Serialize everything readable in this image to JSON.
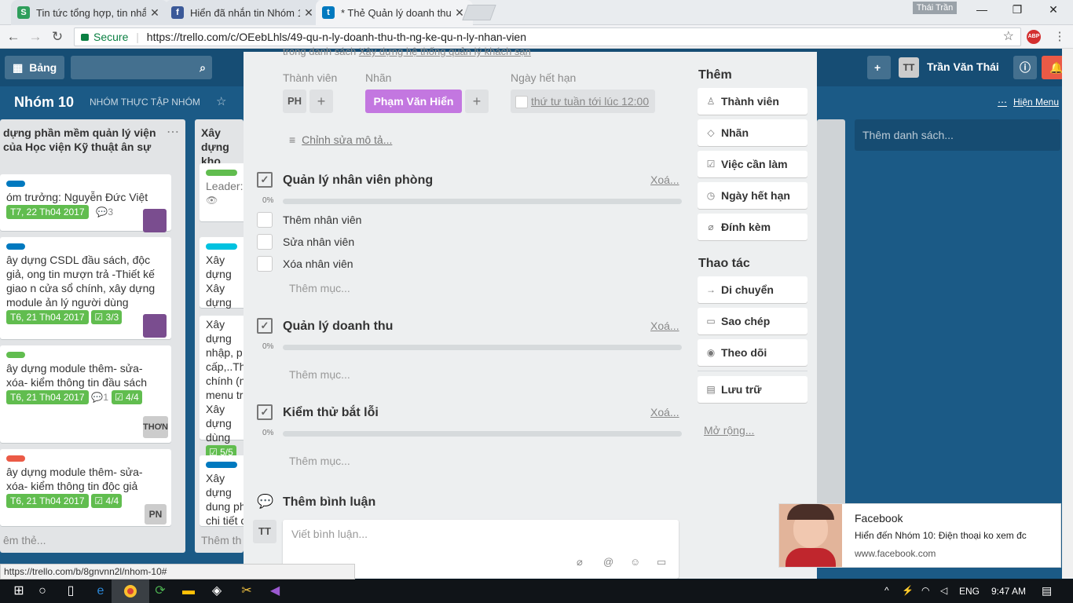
{
  "browser": {
    "tabs": [
      {
        "label": "Tin tức tổng hợp, tin nhắ",
        "icon": "S"
      },
      {
        "label": "Hiển đã nhắn tin Nhóm 1",
        "icon": "f"
      },
      {
        "label": "* Thẻ Quản lý doanh thu",
        "icon": "t"
      }
    ],
    "user": "Thái Trần",
    "secure_label": "Secure",
    "url": "https://trello.com/c/OEebLhls/49-qu-n-ly-doanh-thu-th-ng-ke-qu-n-ly-nhan-vien",
    "status_url": "https://trello.com/b/8gnvnn2l/nhom-10#"
  },
  "board": {
    "boards_label": "Bảng",
    "name": "Nhóm 10",
    "team": "NHÓM THỰC TẬP NHÓM",
    "user_name": "Trần Văn Thái",
    "user_initials": "TT",
    "show_menu": "Hiện Menu",
    "add_list": "Thêm danh sách...",
    "list1": {
      "title": "dựng phần mềm quản lý viện của Học viện Kỹ thuật ân sự",
      "cards": [
        {
          "text": "óm trưởng: Nguyễn Đức Việt",
          "due": "T7, 22 Th04 2017",
          "comments": "3"
        },
        {
          "text": "ây dựng CSDL đầu sách, độc giả, ong tin mượn trả -Thiết kế giao n cửa sổ chính, xây dựng module ản lý người dùng",
          "due": "T6, 21 Th04 2017",
          "check": "3/3"
        },
        {
          "text": "ây dựng module thêm- sửa- xóa- kiểm thông tin đầu sách",
          "due": "T6, 21 Th04 2017",
          "comments": "1",
          "check": "4/4",
          "member": "THƠN"
        },
        {
          "text": "ây dựng module thêm- sửa- xóa- kiểm thông tin độc giả",
          "due": "T6, 21 Th04 2017",
          "check": "4/4",
          "member": "PN"
        }
      ],
      "add": "êm thẻ..."
    },
    "list2": {
      "title": "Xây dựng kho",
      "cards": [
        {
          "text": "Leader:"
        },
        {
          "text": "Xây dựng Xây dựng"
        },
        {
          "text": "Xây dựng nhập, p cấp,..Th chính (n menu tr Xây dựng dùng",
          "check": "5/5"
        },
        {
          "text": "Xây dựng dung ph chi tiết c"
        }
      ],
      "add": "Thêm th"
    }
  },
  "modal": {
    "header_text": "trong danh sách",
    "header_link": "Xây dựng hệ thống quản lý khách sạn",
    "members_label": "Thành viên",
    "member_initials": "PH",
    "labels_label": "Nhãn",
    "label_value": "Phạm Văn Hiển",
    "due_label": "Ngày hết hạn",
    "due_value": "thứ tư tuần tới lúc 12:00",
    "edit_desc": "Chỉnh sửa mô tả...",
    "checklists": [
      {
        "title": "Quản lý nhân viên phòng",
        "delete": "Xoá...",
        "pct": "0%",
        "items": [
          "Thêm nhân viên",
          "Sửa nhân viên",
          "Xóa nhân viên"
        ],
        "add": "Thêm mục..."
      },
      {
        "title": "Quản lý doanh thu",
        "delete": "Xoá...",
        "pct": "0%",
        "add": "Thêm mục..."
      },
      {
        "title": "Kiểm thử bắt lỗi",
        "delete": "Xoá...",
        "pct": "0%",
        "add": "Thêm mục..."
      }
    ],
    "comment_title": "Thêm bình luận",
    "comment_initials": "TT",
    "comment_placeholder": "Viết bình luận...",
    "add_title": "Thêm",
    "add_buttons": [
      "Thành viên",
      "Nhãn",
      "Việc cần làm",
      "Ngày hết hạn",
      "Đính kèm"
    ],
    "actions_title": "Thao tác",
    "action_buttons": [
      "Di chuyển",
      "Sao chép",
      "Theo dõi",
      "Lưu trữ"
    ],
    "more": "Mở rộng..."
  },
  "notification": {
    "app": "Facebook",
    "message": "Hiển đến Nhóm 10: Điện thoại ko xem đc",
    "site": "www.facebook.com"
  },
  "taskbar": {
    "lang": "ENG",
    "time": "9:47 AM"
  },
  "colors": {
    "board_bg": "#1b5a86",
    "label_purple": "#c377e0",
    "due_green": "#61bd4f"
  }
}
